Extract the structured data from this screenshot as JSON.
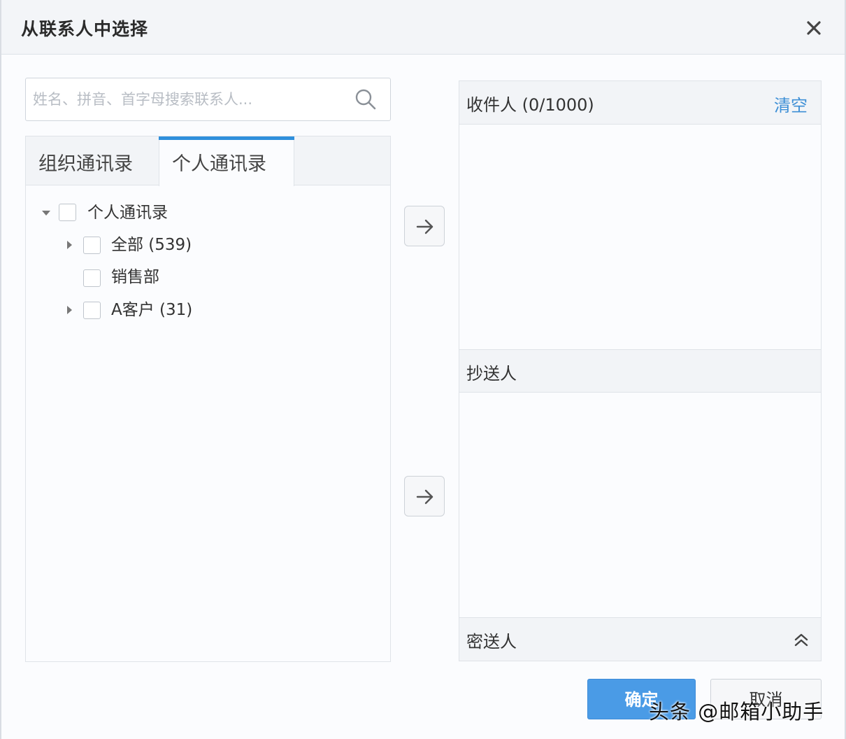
{
  "dialog": {
    "title": "从联系人中选择",
    "close_icon": "close-icon"
  },
  "search": {
    "placeholder": "姓名、拼音、首字母搜索联系人...",
    "value": "",
    "icon": "search-icon"
  },
  "tabs": [
    {
      "label": "组织通讯录",
      "active": false
    },
    {
      "label": "个人通讯录",
      "active": true
    }
  ],
  "tree": {
    "root": {
      "label": "个人通讯录",
      "expanded": true,
      "checked": false
    },
    "children": [
      {
        "label": "全部 (539)",
        "expandable": true,
        "checked": false
      },
      {
        "label": "销售部",
        "expandable": false,
        "checked": false
      },
      {
        "label": "A客户 (31)",
        "expandable": true,
        "checked": false
      }
    ]
  },
  "add_buttons": {
    "to_recipients_icon": "arrow-right-icon",
    "to_cc_icon": "arrow-right-icon"
  },
  "recipients": {
    "to_label": "收件人 (0/1000)",
    "clear_label": "清空",
    "cc_label": "抄送人",
    "bcc_label": "密送人",
    "bcc_icon": "double-chevron-up-icon"
  },
  "footer": {
    "ok_label": "确定",
    "cancel_label": "取消"
  },
  "watermark": {
    "text": "头条 @邮箱小助手"
  },
  "colors": {
    "accent": "#4a9be6",
    "tab_indicator": "#2f8fdc",
    "link": "#3d8fd6"
  }
}
